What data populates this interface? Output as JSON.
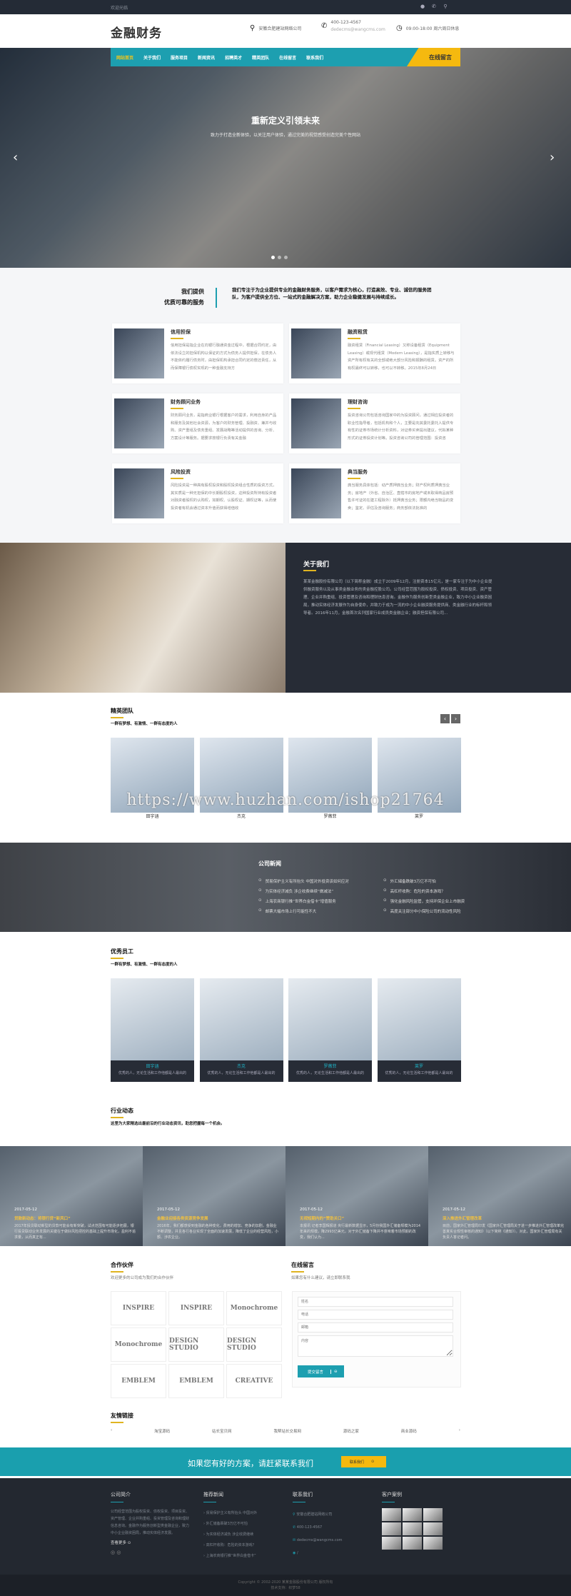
{
  "topbar": {
    "welcome": "欢迎光临",
    "icons": [
      "qq-icon",
      "wechat-icon",
      "search-icon"
    ]
  },
  "header": {
    "logo": "金融财务",
    "address": "安徽合肥建站网络公司",
    "phone": "400-123-4567",
    "email": "dedecms@wangcms.com",
    "hours": "09:00-18:00 周六周日休息"
  },
  "nav": {
    "items": [
      "网站首页",
      "关于我们",
      "服务项目",
      "新闻资讯",
      "招聘英才",
      "精英团队",
      "在线留言",
      "联系我们"
    ],
    "cta": "在线留言"
  },
  "hero": {
    "title": "重新定义引领未来",
    "subtitle": "致力于打造全新体验，以关注用户体验，通过完美的视觉感受创造完美个性网站",
    "slides": 3,
    "active_slide": 1
  },
  "intro": {
    "heading1": "我们提供",
    "heading2": "优质可靠的服务",
    "text": "我们专注于为企业提供专业的金融财务服务，以客户需求为核心，打造高效、专业、诚信的服务团队，为客户提供全方位、一站式的金融解决方案，助力企业稳健发展与持续成长。",
    "services": [
      {
        "title": "信用担保",
        "desc": "信用担保是指企业在向银行融通资金过程中，根据合同约定，由依法设立的担保机构以保证的方式为债务人提供担保，在债务人不能依约履行债务时，由担保机构承担合同约定的偿还责任，从而保障银行债权实现的一种金融支持方"
      },
      {
        "title": "融资租赁",
        "desc": "融资租赁（Financial Leasing）又称设备租赁（Equipment Leasing）或现代租赁（Modern Leasing），是指实质上转移与资产所有权有关的全部或绝大部分风险和报酬的租赁。资产的所有权最终可以转移，也可以不转移。2015年8月24日"
      },
      {
        "title": "财务顾问业务",
        "desc": "财务顾问业务，是指商业银行根据客户的需求，利用自身的产品和服务及其他社会资源，为客户的财务管理、投融资、兼并与收购、资产重组及债务重组、发展战略等活动提供的咨询、分析、方案设计等服务。据要求按银行负责有关金融"
      },
      {
        "title": "理财咨询",
        "desc": "投资咨询公司包括咨询国家中的为投资顾问，通过相应投资者的职业性指导者，包括机构和个人，主要是向其委托委托人提供专有性的证券市场统计分析资料，对证券买卖提出建议，代拟某种形式的证券投资计划等。投资咨询公司的管理范围：投资咨"
      },
      {
        "title": "风险投资",
        "desc": "风险投资是一种高有股权投资和股权投资组合性质的投资方式，其实质是一种无担保的中长期股权投资，这种投资所持有投资者对融资者股权的认购权，如期权、认股权证、期权证等，从而使投资者有机会通过资本升值而获得增值收"
      },
      {
        "title": "典当服务",
        "desc": "典当服务具体包括：动产质押典当业务；财产权利质押典当业务；房地产（外省、自治区、直辖市的房地产或未取得商品房预售许可证的在建工程除外）抵押典当业务；限额内绝当物品的变卖；鉴定、评估及咨询服务；商务部依法批准的"
      }
    ]
  },
  "about": {
    "title": "关于我们",
    "text": "某某金融股份有限公司（以下简称金融）成立于2009年12月，注册资本15亿元，是一家专注于为中小企业提供融资服务以及从事类金融业务的类金融控股公司。公司经营范围为股权投资、债权投资、项目投资、资产管理、企业并购重组、投资管理及咨询和理财信息咨询。金融作为服务创新型类金融企业，致力中小企业融资困局，推动实体经济发展作为自身使命，并致力于成为一流的中小企业融资服务提供商、类金融行业的标杆和领导者。2016年11月，金融首次名列国家行业成员类金融企业；融资担保有限公司..."
  },
  "team": {
    "title": "精英团队",
    "subtitle": "一群有梦想、有激情、一群有态度的人",
    "members": [
      "田宇涵",
      "杰克",
      "罗薇菲",
      "莱罗"
    ],
    "watermark": "https://www.huzhan.com/ishop21764"
  },
  "company_news": {
    "title": "公司新闻",
    "items": [
      "贸易保护主义有所抬头 中国对外投资该如何应对",
      "为实体经济减负 涉企收费继续“做减法”",
      "上海农商银行推“世界白金借卡”增值服务",
      "邮票大幅市场上行可能性不大",
      "外汇储备跌破3万亿不可怕",
      "高杠杆收购：危险的资本游戏？",
      "强化金融风险监管，支持环保企业上市融资",
      "高度关注部分中小保险公司的流动性风险"
    ]
  },
  "staff": {
    "title": "优秀员工",
    "subtitle": "一群有梦想、有激情、一群有态度的人",
    "members": [
      {
        "name": "田宇涵",
        "desc": "优秀的人，无论生活和工作他都是人最出的"
      },
      {
        "name": "杰克",
        "desc": "优秀的人，无论生活和工作他都是人最出的"
      },
      {
        "name": "罗薇菲",
        "desc": "优秀的人，无论生活和工作他都是人最出的"
      },
      {
        "name": "莱罗",
        "desc": "优秀的人，无论生活和工作他都是人最出的"
      }
    ]
  },
  "industry": {
    "title": "行业动态",
    "subtitle": "这里为大家精选出最前沿的行业动态资讯，助您把握每一个机会。",
    "items": [
      {
        "date": "2017-05-12",
        "title": "贷款新动态：将银行贷“新风口”",
        "desc": "2017年投贷联动新型的贷款可能会有新突破，试点范围有可能逐步拓展，银行投贷联动业务发展的关键在于做好风险把控的基础上提升市场化，盈利不追求量，从而真正有..."
      },
      {
        "date": "2017-05-12",
        "title": "金融业迎接各类资源竞争发展",
        "desc": "2016年，我们都感受到金融的各种变化，费用的增加、竞争的加剧，金融业不断调整，并且各行各业实现了全面的加速发展，降低了企业的经营风险，小额、涉农企业。"
      },
      {
        "date": "2017-05-12",
        "title": "无视短期内的“赞助关口”",
        "desc": "本报讯 记者李国辉报道 央行最新数据显示，5月份我国外汇储备规模为2014年来的规模，降2993亿美元，对于外汇储备下降并不意味着市场预期的改变，我们认为..."
      },
      {
        "date": "2017-05-12",
        "title": "深入推进外汇管理改革",
        "desc": "目前，国家外汇管理局印发《国家外汇管理局关于进一步推进外汇管理改革完善真实合规性审核的通知》（以下简称《通知》）。对此，国家外汇管理局有关负责人答记者问。"
      }
    ]
  },
  "partners": {
    "title": "合作伙伴",
    "subtitle": "欢迎更多的公司成为我们的合作伙伴",
    "logos": [
      "INSPIRE",
      "INSPIRE",
      "Monochrome",
      "Monochrome",
      "DESIGN STUDIO",
      "DESIGN STUDIO",
      "EMBLEM",
      "EMBLEM",
      "CREATIVE"
    ]
  },
  "message": {
    "title": "在线留言",
    "subtitle": "如果您有什么建议，请立即联系我",
    "name_ph": "姓名",
    "phone_ph": "电话",
    "email_ph": "邮箱",
    "content_ph": "内容",
    "submit": "提交留言"
  },
  "links": {
    "title": "友情链接",
    "items": [
      "淘宝源码",
      "站长宝贝网",
      "我帮站长交易网",
      "源码之家",
      "商业源码"
    ]
  },
  "cta": {
    "text": "如果您有好的方案，请赶紧联系我们",
    "button": "联系我们"
  },
  "footer": {
    "about": {
      "title": "公司简介",
      "text": "公司经营范围为股权投资、债权投资、项目投资、资产管理、企业并购重组、投资管理及咨询和理财信息咨询。金融作为服务创新型类金融企业，致力中小企业融资困局，推动实体经济发展。",
      "more": "查看更多"
    },
    "news": {
      "title": "推荐新闻",
      "items": [
        "贸易保护主义有所抬头 中国对外",
        "外汇储备跌破3万亿不可怕",
        "为实体经济减负 涉企收费继续",
        "高杠杆收购：危险的资本游戏？",
        "上海农商银行推“世界白金借卡”"
      ]
    },
    "contact": {
      "title": "联系我们",
      "address": "安徽合肥建站网络公司",
      "phone": "400-123-4567",
      "email": "dedecms@wangcms.com",
      "web": "/"
    },
    "cases": {
      "title": "客户案例",
      "count": 9
    },
    "copyright": "Copyright © 2002-2020 某某金融股份有限公司 版权所有",
    "support": "技术支持：织梦58"
  },
  "colors": {
    "primary": "#1d9fb0",
    "accent": "#f5b90f",
    "dark": "#272c36"
  }
}
